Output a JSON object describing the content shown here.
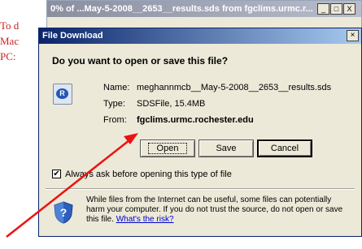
{
  "background": {
    "line1": "To d",
    "line2": "Mac",
    "line3": "PC:"
  },
  "progress_window": {
    "title": "0% of ...May-5-2008__2653__results.sds from fgclims.urmc.r...",
    "minimize": "_",
    "maximize": "□",
    "close": "X"
  },
  "dialog": {
    "title": "File Download",
    "close": "×",
    "question": "Do you want to open or save this file?",
    "file_icon_letter": "R",
    "name_label": "Name:",
    "name_value": "meghannmcb__May-5-2008__2653__results.sds",
    "type_label": "Type:",
    "type_value": "SDSFile, 15.4MB",
    "from_label": "From:",
    "from_value": "fgclims.urmc.rochester.edu",
    "buttons": {
      "open": "Open",
      "save": "Save",
      "cancel": "Cancel"
    },
    "checkbox_mark": "✔",
    "checkbox_label": "Always ask before opening this type of file",
    "warning_text": "While files from the Internet can be useful, some files can potentially harm your computer. If you do not trust the source, do not open or save this file.",
    "warning_link": "What's the risk?"
  },
  "colors": {
    "arrow": "#ee1111",
    "title_start": "#0a246a",
    "title_end": "#a6caf0"
  }
}
